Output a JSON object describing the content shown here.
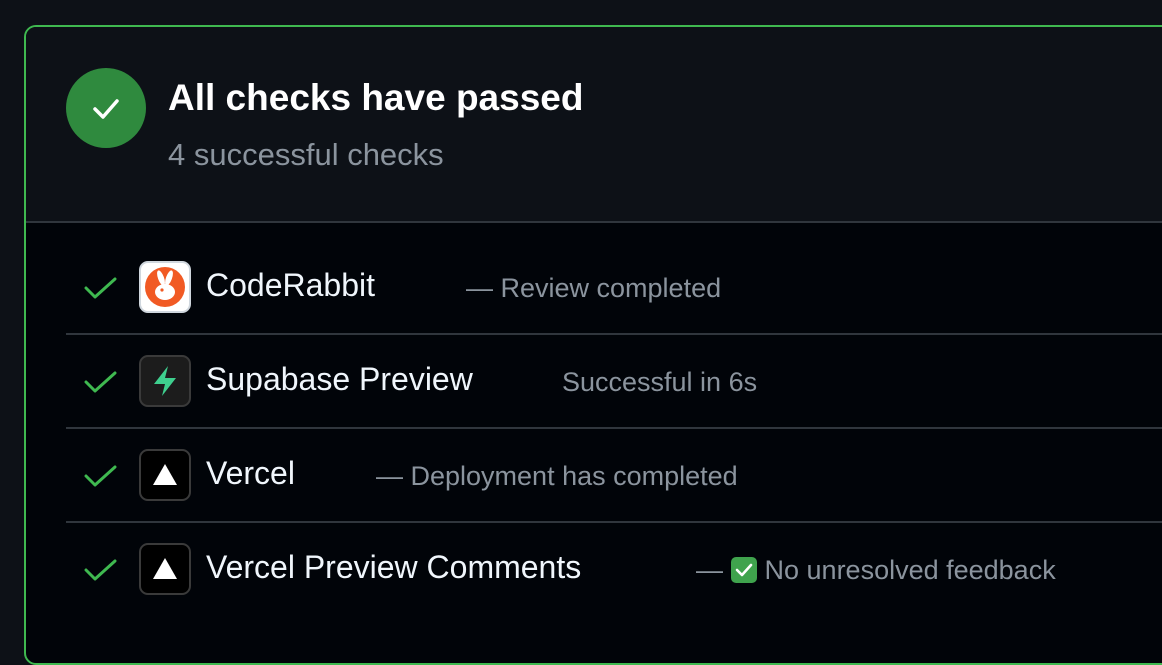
{
  "summary": {
    "title": "All checks have passed",
    "subtitle": "4 successful checks",
    "icon": "check-circle-icon",
    "accent_color": "#3fb950",
    "circle_color": "#2f8a3e"
  },
  "checks": [
    {
      "name": "CodeRabbit",
      "description": "— Review completed",
      "icon": "coderabbit-icon",
      "status": "passed"
    },
    {
      "name": "Supabase Preview",
      "description": "Successful in 6s",
      "icon": "supabase-icon",
      "status": "passed"
    },
    {
      "name": "Vercel",
      "description": "— Deployment has completed",
      "icon": "vercel-icon",
      "status": "passed"
    },
    {
      "name": "Vercel Preview Comments",
      "description_prefix": "—",
      "description_emoji": "white-check-mark-emoji",
      "description": "No unresolved feedback",
      "icon": "vercel-icon",
      "status": "passed"
    }
  ]
}
